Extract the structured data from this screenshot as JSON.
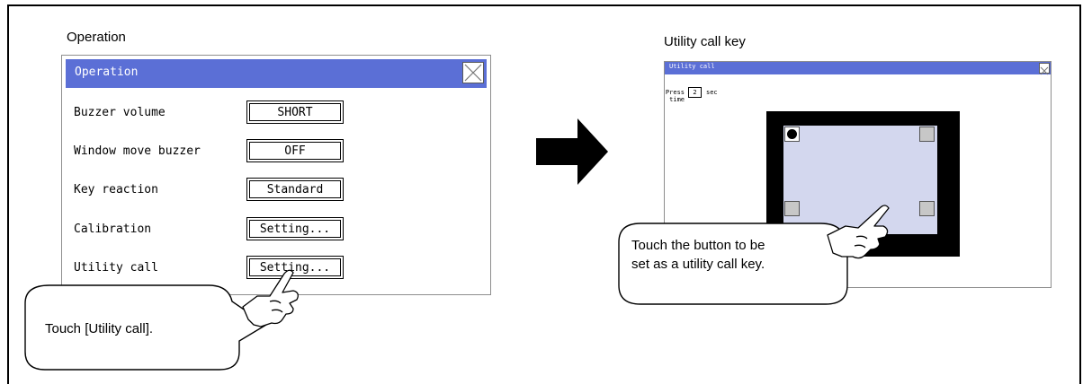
{
  "left": {
    "heading": "Operation",
    "window_title": "Operation",
    "rows": [
      {
        "label": "Buzzer volume",
        "value": "SHORT"
      },
      {
        "label": "Window move buzzer",
        "value": "OFF"
      },
      {
        "label": "Key reaction",
        "value": "Standard"
      },
      {
        "label": "Calibration",
        "value": "Setting..."
      },
      {
        "label": "Utility call",
        "value": "Setting..."
      }
    ],
    "callout": "Touch [Utility call]."
  },
  "right": {
    "heading": "Utility call key",
    "window_title": "Utility call",
    "press_time_label": "Press time",
    "press_time_value": "2",
    "press_time_unit": "sec",
    "callout_line1": "Touch the button to be",
    "callout_line2": "set as a utility call key."
  },
  "colors": {
    "titlebar": "#5b6fd6",
    "touch_area": "#d3d7ee",
    "corner_button": "#c7c7c7"
  },
  "icons": [
    "close-icon",
    "arrow-right-icon",
    "pointing-hand-icon"
  ]
}
